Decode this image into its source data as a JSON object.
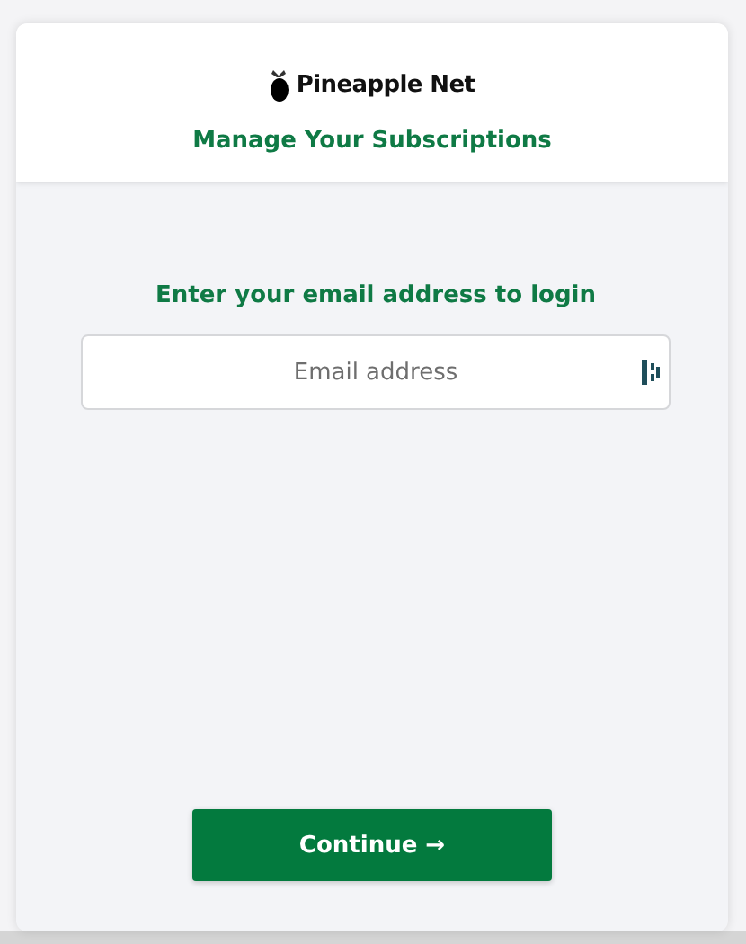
{
  "brand": {
    "name": "Pineapple Net"
  },
  "header": {
    "title": "Manage Your Subscriptions"
  },
  "login": {
    "prompt": "Enter your email address to login",
    "email_field": {
      "placeholder": "Email address"
    }
  },
  "buttons": [
    {
      "label": "Continue →"
    }
  ]
}
